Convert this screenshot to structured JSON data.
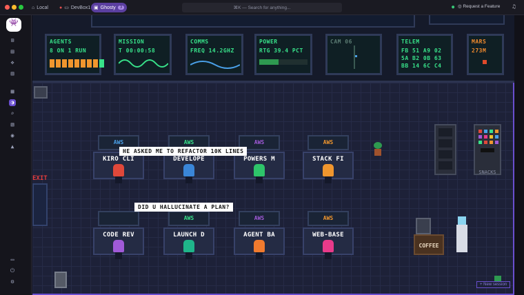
{
  "window": {
    "tabs": [
      {
        "label": "Local"
      },
      {
        "label": "DevBox1"
      },
      {
        "label": "Ghosty",
        "count": "3"
      }
    ],
    "search_placeholder": "⌘K — Search for anything...",
    "request_feature": "Request a Feature"
  },
  "monitors": [
    {
      "title": "AGENTS",
      "lines": [
        "8 ON  1 RUN"
      ]
    },
    {
      "title": "MISSION",
      "lines": [
        "T 00:00:58"
      ]
    },
    {
      "title": "COMMS",
      "lines": [
        "FREQ 14.2GHZ"
      ]
    },
    {
      "title": "POWER",
      "lines": [
        "RTG 39.4 PCT"
      ]
    },
    {
      "title": "CAM 06",
      "lines": []
    },
    {
      "title": "TELEM",
      "lines": [
        "FB 51 A9 02",
        "5A B2 0B 63",
        "BB 14 6C C4"
      ]
    },
    {
      "title": "MARS",
      "lines": [
        "273M"
      ]
    }
  ],
  "desks": [
    {
      "screen": "AWS",
      "label": "KIRO CLI",
      "chair": "#e0483a"
    },
    {
      "screen": "AWS",
      "label": "DEVELOPE",
      "chair": "#3a86d8"
    },
    {
      "screen": "AWS",
      "label": "POWERS M",
      "chair": "#2ec46a"
    },
    {
      "screen": "AWS",
      "label": "STACK FI",
      "chair": "#f0962e"
    },
    {
      "screen": "",
      "label": "CODE REV",
      "chair": "#a05ad8"
    },
    {
      "screen": "AWS",
      "label": "LAUNCH D",
      "chair": "#1fb58a"
    },
    {
      "screen": "AWS",
      "label": "AGENT BA",
      "chair": "#f07a2e"
    },
    {
      "screen": "AWS",
      "label": "WEB-BASE",
      "chair": "#e83a8a"
    }
  ],
  "bubbles": [
    "HE ASKED ME TO REFACTOR 10K LINES",
    "DID U HALLUCINATE A PLAN?"
  ],
  "exit": "EXIT",
  "snacks": "SNACKS",
  "coffee": "COFFEE",
  "new_session": "+ New session"
}
